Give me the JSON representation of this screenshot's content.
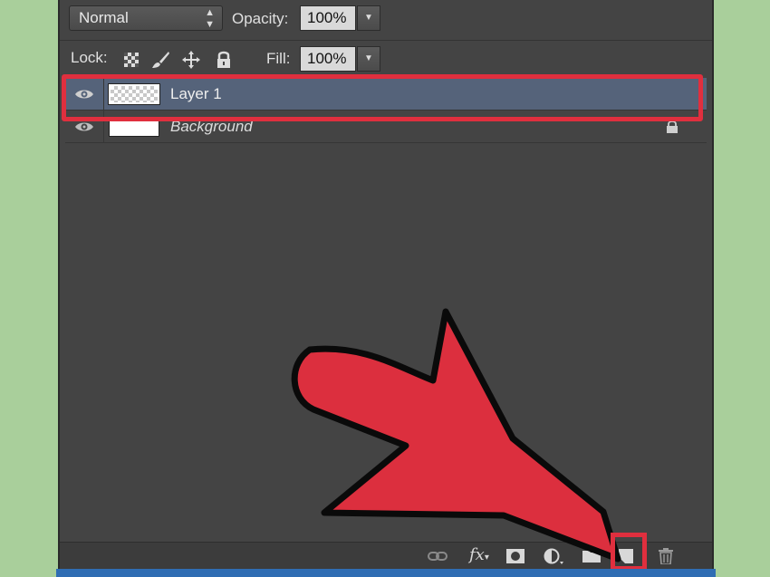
{
  "toolbar": {
    "blend_mode": "Normal",
    "opacity_label": "Opacity:",
    "opacity_value": "100%",
    "lock_label": "Lock:",
    "fill_label": "Fill:",
    "fill_value": "100%",
    "lock_icons": [
      "lock-transparent-pixels-icon",
      "lock-image-pixels-icon",
      "lock-position-icon",
      "lock-all-icon"
    ]
  },
  "layers": [
    {
      "name": "Layer 1",
      "selected": true,
      "visible": true,
      "thumbnail": "transparent"
    },
    {
      "name": "Background",
      "selected": false,
      "visible": true,
      "thumbnail": "white",
      "locked": true
    }
  ],
  "bottom_bar": {
    "icons": [
      "link-layers-icon",
      "fx-layer-style-icon",
      "add-mask-icon",
      "adjustment-layer-icon",
      "new-group-icon",
      "new-layer-icon",
      "delete-layer-icon"
    ],
    "fx_label": "fx"
  },
  "colors": {
    "panel_bg": "#444444",
    "selected_row": "#55637a",
    "highlight": "#e02f3e",
    "page_bg": "#a9cf9b"
  }
}
